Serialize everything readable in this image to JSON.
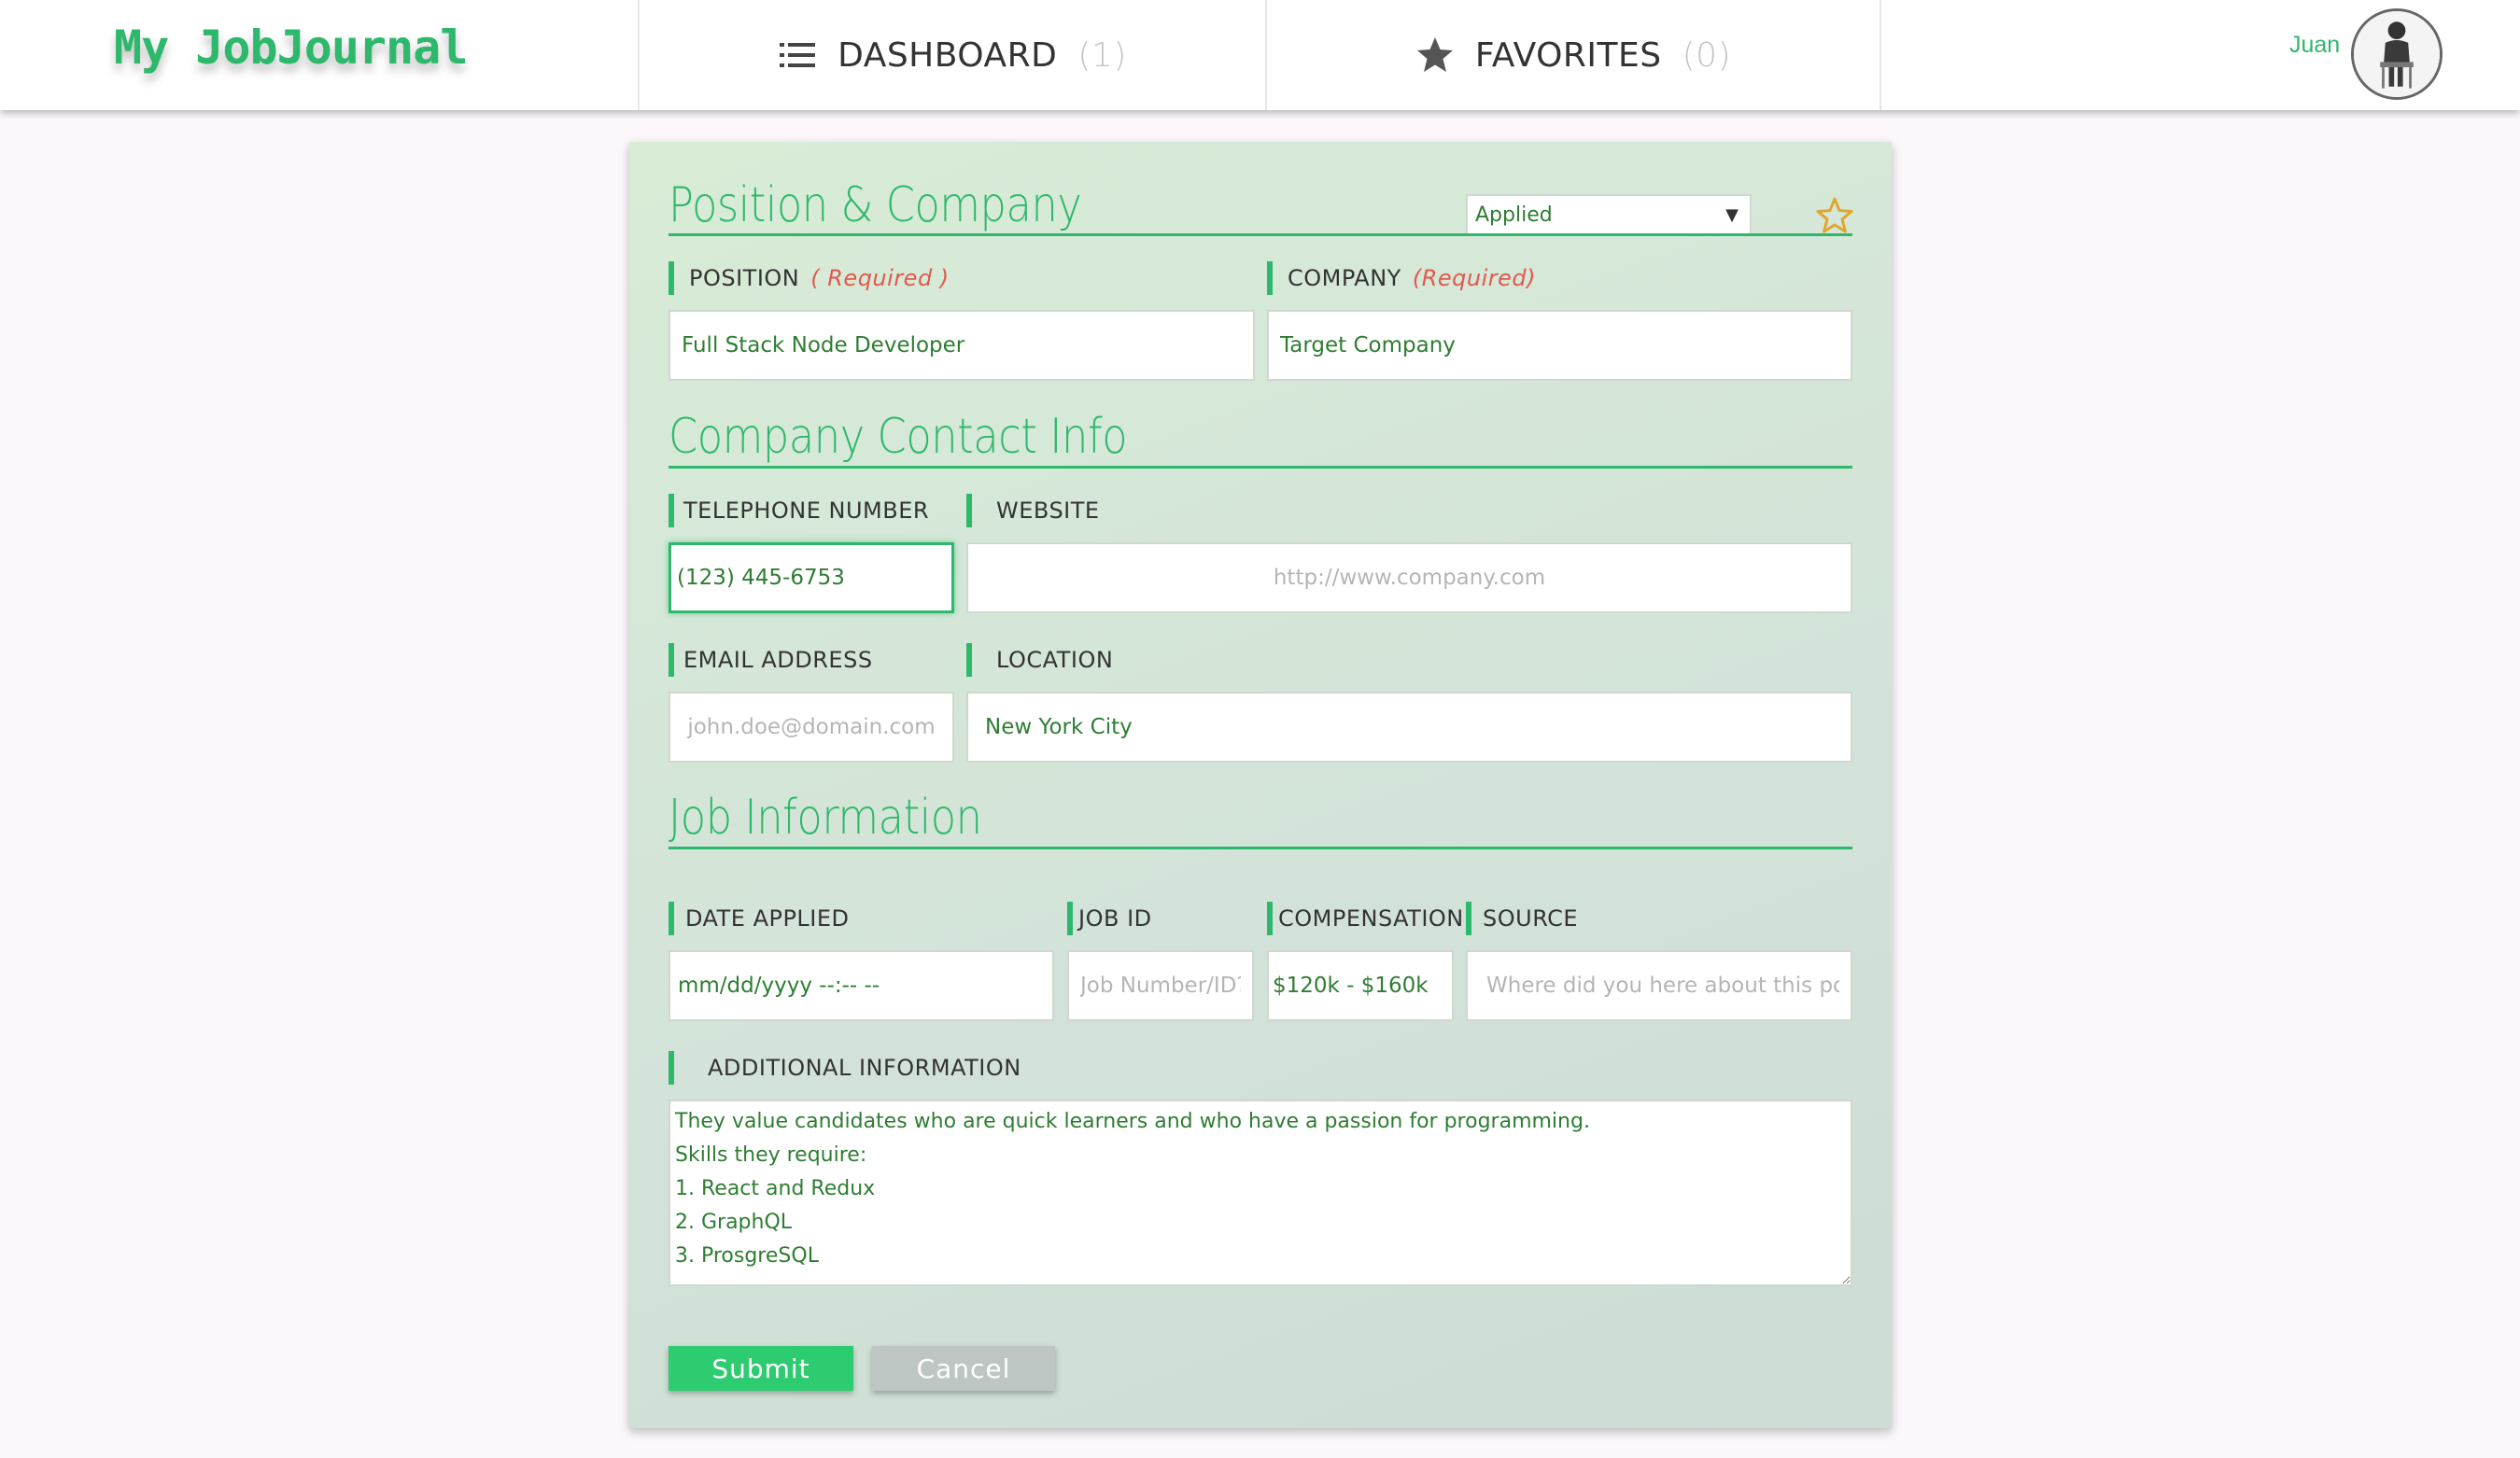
{
  "navbar": {
    "brand": "My JobJournal",
    "dashboard": {
      "label": "DASHBOARD",
      "count": "(1)",
      "icon": "list-icon"
    },
    "favorites": {
      "label": "FAVORITES",
      "count": "(0)",
      "icon": "star-icon"
    },
    "user_name": "Juan",
    "avatar_icon": "avatar-icon"
  },
  "form": {
    "section_position": {
      "title": "Position & Company",
      "status_select": {
        "value": "Applied",
        "options_visible": [
          "Applied"
        ]
      },
      "favorite_icon": "star-outline-icon",
      "position_label": "POSITION",
      "position_required": "( Required )",
      "position_value": "Full Stack Node Developer",
      "company_label": "COMPANY",
      "company_required": "(Required)",
      "company_value": "Target Company"
    },
    "section_contact": {
      "title": "Company Contact Info",
      "telephone_label": "TELEPHONE NUMBER",
      "telephone_value": "(123) 445-6753",
      "website_label": "WEBSITE",
      "website_placeholder": "http://www.company.com",
      "email_label": "EMAIL ADDRESS",
      "email_placeholder": "john.doe@domain.com",
      "location_label": "LOCATION",
      "location_value": "New York City"
    },
    "section_job": {
      "title": "Job Information",
      "date_label": "DATE APPLIED",
      "date_value": "mm/dd/yyyy --:-- --",
      "jobid_label": "JOB ID",
      "jobid_placeholder": "Job Number/ID?",
      "comp_label": "COMPENSATION",
      "comp_value": "$120k - $160k",
      "source_label": "SOURCE",
      "source_placeholder": "Where did you here about this position?",
      "additional_label": "ADDITIONAL INFORMATION",
      "additional_value": "They value candidates who are quick learners and who have a passion for programming.\nSkills they require:\n1. React and Redux\n2. GraphQL\n3. ProsgreSQL"
    },
    "submit_label": "Submit",
    "cancel_label": "Cancel"
  },
  "colors": {
    "accent": "#2eb86b",
    "required": "#e05a4f",
    "favorite_star": "#e0a72e",
    "submit": "#2ecc71",
    "cancel": "#bdc6c3"
  }
}
